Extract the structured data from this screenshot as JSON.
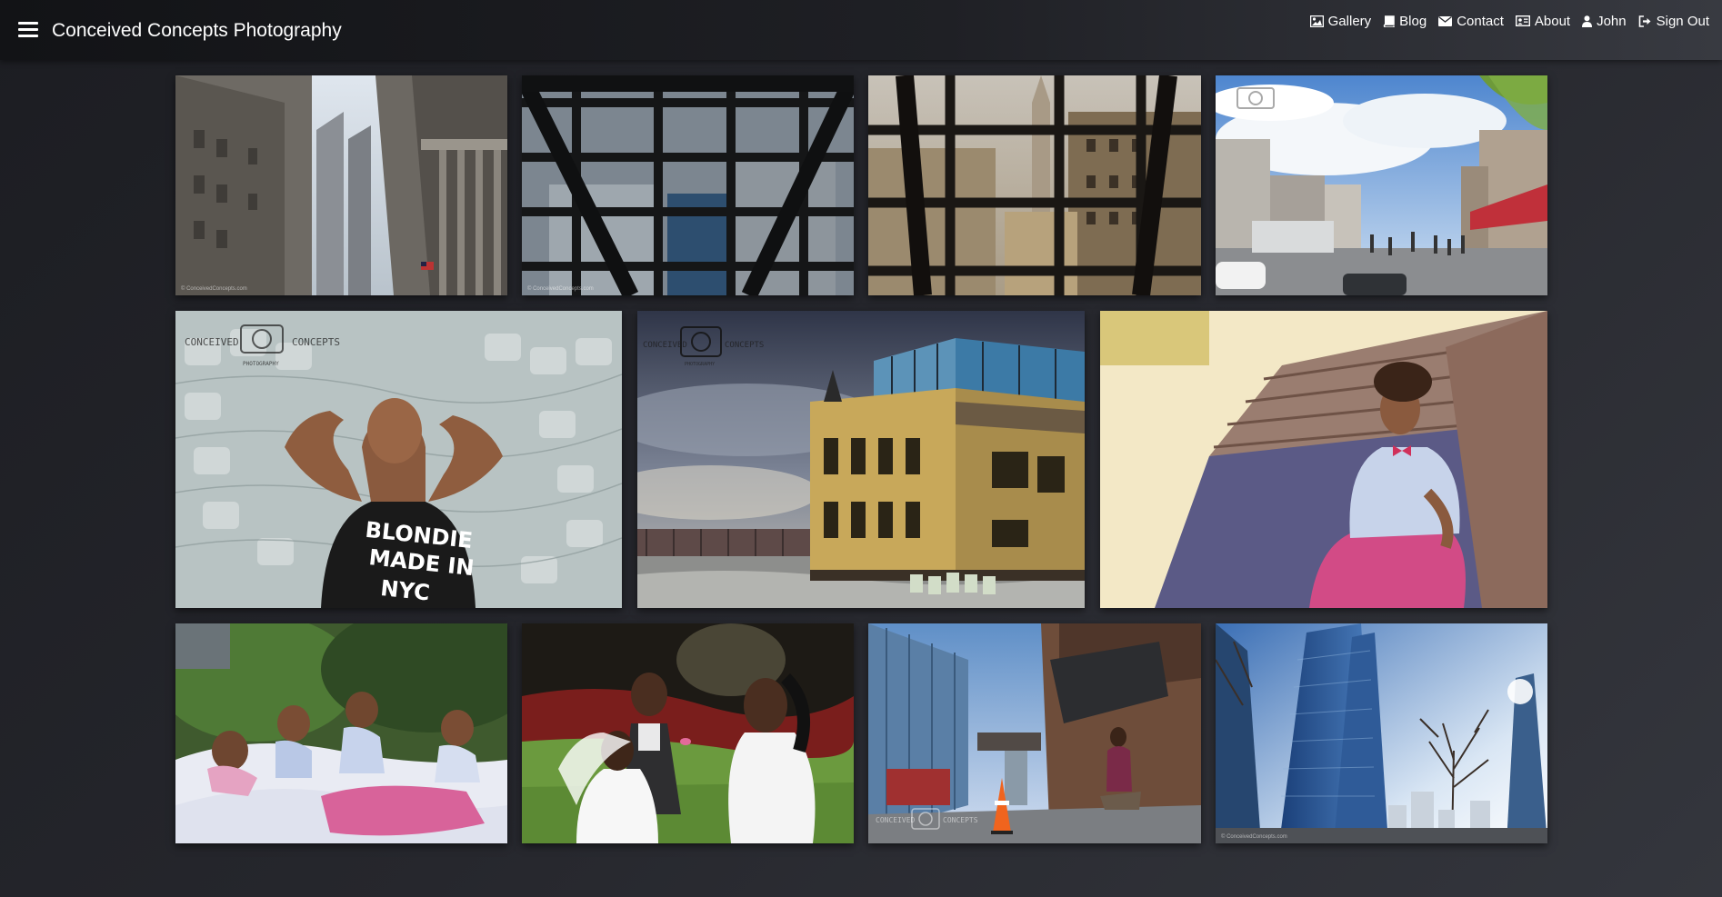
{
  "app": {
    "title": "Conceived Concepts Photography"
  },
  "nav": {
    "items": [
      {
        "label": "Gallery",
        "icon": "image-icon"
      },
      {
        "label": "Blog",
        "icon": "book-icon"
      },
      {
        "label": "Contact",
        "icon": "envelope-icon"
      },
      {
        "label": "About",
        "icon": "id-card-icon"
      },
      {
        "label": "John",
        "icon": "user-icon"
      },
      {
        "label": "Sign Out",
        "icon": "sign-out-icon"
      }
    ]
  },
  "watermark": {
    "left": "CONCEIVED",
    "right": "CONCEPTS",
    "sub": "PHOTOGRAPHY"
  },
  "colors": {
    "text": "#ffffff",
    "background": "#26272d"
  }
}
